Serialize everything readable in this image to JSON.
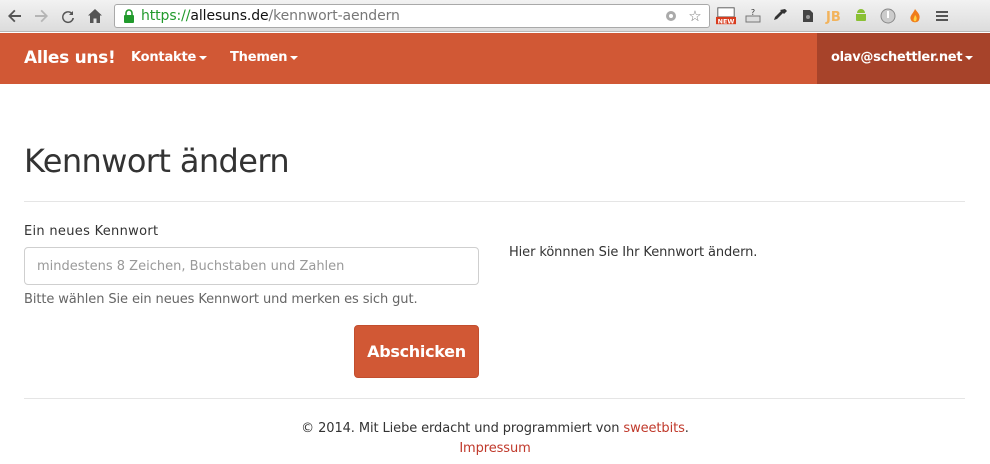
{
  "browser": {
    "url_scheme": "https://",
    "url_host": "allesuns.de",
    "url_path": "/kennwort-aendern",
    "ext_new_badge": "NEW",
    "ext_jb_label": "JB"
  },
  "navbar": {
    "brand": "Alles uns!",
    "menu": [
      {
        "label": "Kontakte"
      },
      {
        "label": "Themen"
      }
    ],
    "user_email": "olav@schettler.net",
    "accent": "#d15835",
    "user_bg": "#a7432a"
  },
  "main": {
    "title": "Kennwort ändern",
    "field_label": "Ein neues Kennwort",
    "placeholder": "mindestens 8 Zeichen, Buchstaben und Zahlen",
    "help": "Bitte wählen Sie ein neues Kennwort und merken es sich gut.",
    "side_note": "Hier könnnen Sie Ihr Kennwort ändern.",
    "submit_label": "Abschicken"
  },
  "footer": {
    "text_before": "© 2014. Mit Liebe erdacht und programmiert von ",
    "link_sweetbits": "sweetbits",
    "text_after": ".",
    "impressum": "Impressum"
  }
}
